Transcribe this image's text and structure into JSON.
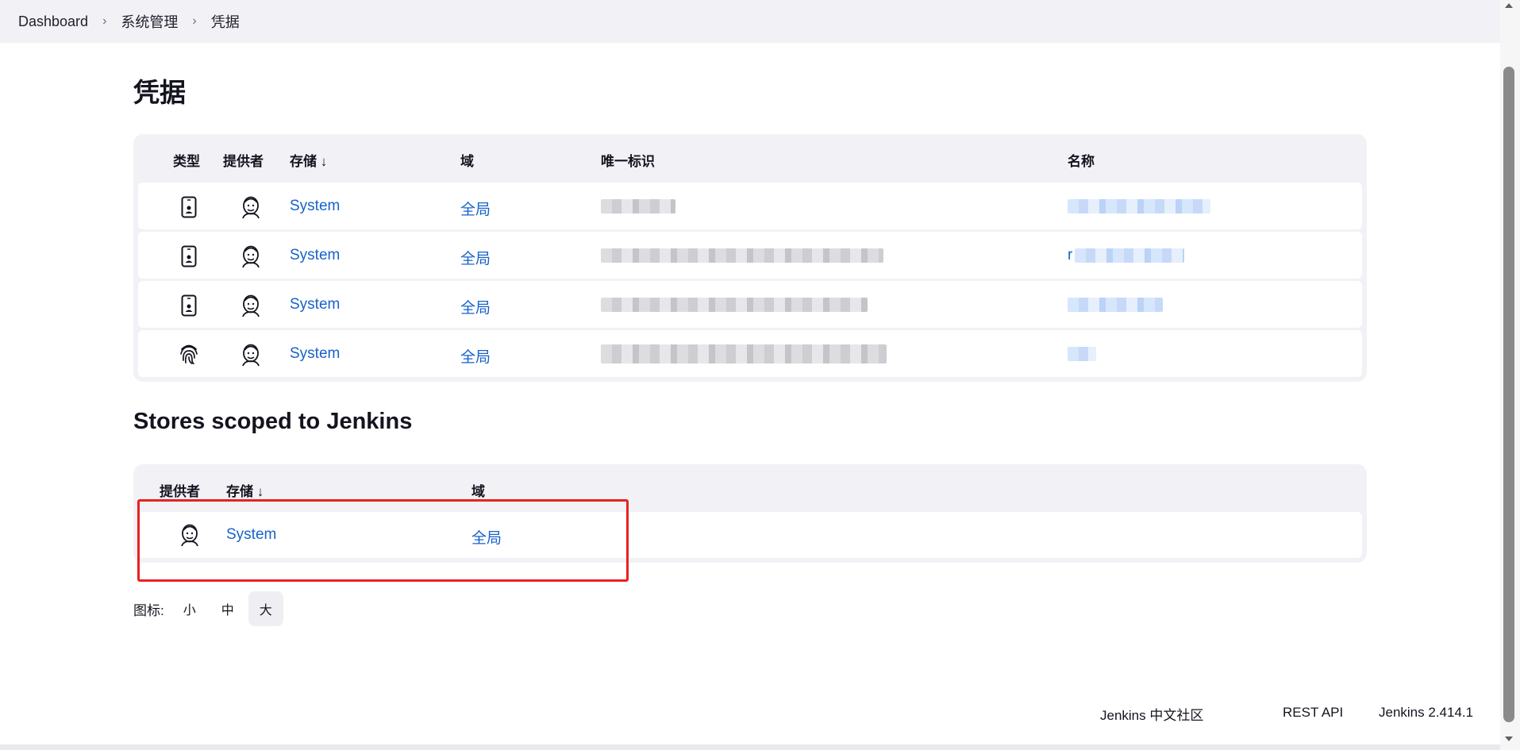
{
  "breadcrumb": {
    "items": [
      "Dashboard",
      "系统管理",
      "凭据"
    ]
  },
  "page_title": "凭据",
  "credentials_table": {
    "headers": {
      "type": "类型",
      "provider": "提供者",
      "store": "存储 ↓",
      "domain": "域",
      "id": "唯一标识",
      "name": "名称"
    },
    "rows": [
      {
        "type_icon": "mobile-id-icon",
        "provider_icon": "jenkins-icon",
        "store": "System",
        "domain": "全局"
      },
      {
        "type_icon": "mobile-id-icon",
        "provider_icon": "jenkins-icon",
        "store": "System",
        "domain": "全局",
        "name_prefix": "r"
      },
      {
        "type_icon": "mobile-id-icon",
        "provider_icon": "jenkins-icon",
        "store": "System",
        "domain": "全局"
      },
      {
        "type_icon": "fingerprint-icon",
        "provider_icon": "jenkins-icon",
        "store": "System",
        "domain": "全局"
      }
    ]
  },
  "stores_section": {
    "title": "Stores scoped to Jenkins",
    "headers": {
      "provider": "提供者",
      "store": "存储 ↓",
      "domain": "域"
    },
    "rows": [
      {
        "provider_icon": "jenkins-icon",
        "store": "System",
        "domain": "全局"
      }
    ]
  },
  "icon_size": {
    "label": "图标:",
    "options": [
      "小",
      "中",
      "大"
    ],
    "selected": "大"
  },
  "footer": {
    "community": "Jenkins 中文社区",
    "rest_api": "REST API",
    "version": "Jenkins 2.414.1"
  },
  "colors": {
    "link": "#1762c9",
    "table_bg": "#f2f1f6",
    "highlight_box": "#e8221f"
  }
}
